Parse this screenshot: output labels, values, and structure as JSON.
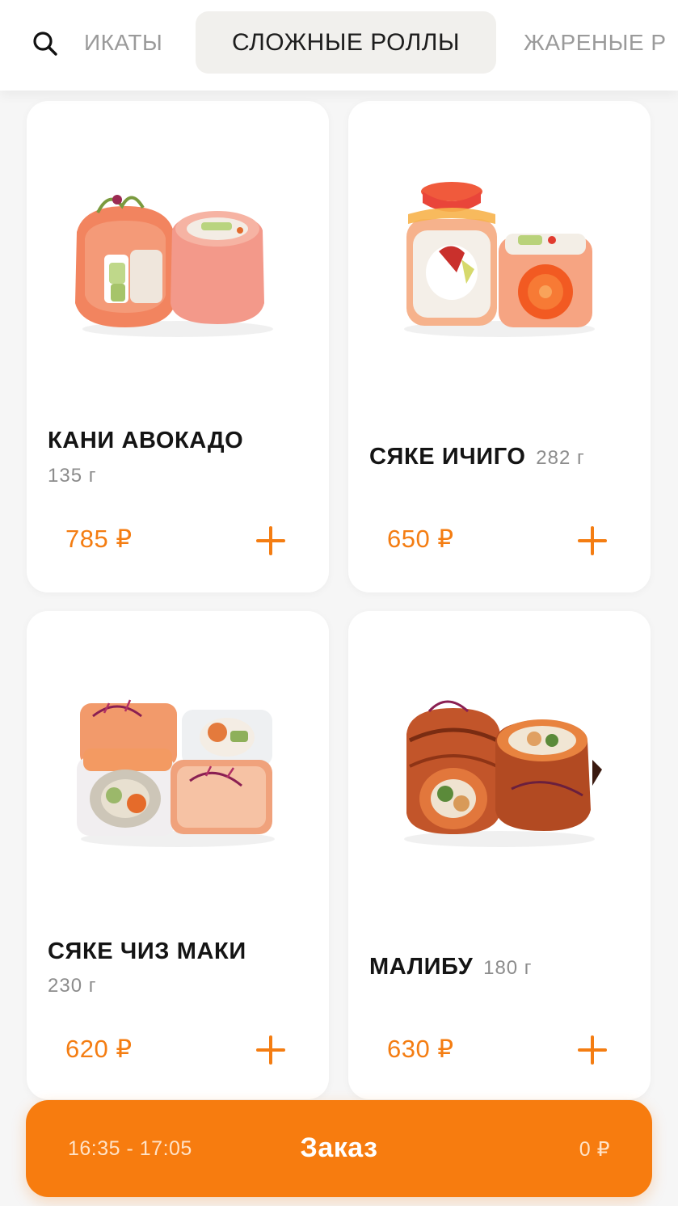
{
  "categories": {
    "previous": "ИКАТЫ",
    "active": "СЛОЖНЫЕ РОЛЛЫ",
    "next": "ЖАРЕНЫЕ Р"
  },
  "products": [
    {
      "name": "КАНИ АВОКАДО",
      "weight": "135 г",
      "price": "785 ₽"
    },
    {
      "name": "СЯКЕ ИЧИГО",
      "weight": "282 г",
      "price": "650 ₽"
    },
    {
      "name": "СЯКЕ ЧИЗ МАКИ",
      "weight": "230 г",
      "price": "620 ₽"
    },
    {
      "name": "МАЛИБУ",
      "weight": "180 г",
      "price": "630 ₽"
    }
  ],
  "order": {
    "time": "16:35 - 17:05",
    "label": "Заказ",
    "sum": "0 ₽"
  },
  "colors": {
    "accent": "#f47d12",
    "order_bar": "#f77c0f",
    "active_tab_bg": "#f1f0ed"
  },
  "icons": {
    "search": "search-icon",
    "add": "plus-icon"
  }
}
